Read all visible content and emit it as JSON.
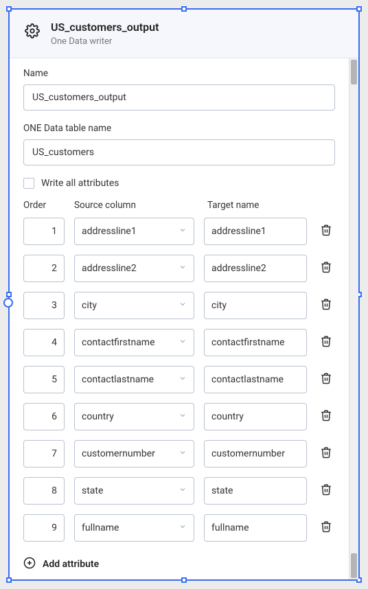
{
  "header": {
    "title": "US_customers_output",
    "subtitle": "One Data writer"
  },
  "fields": {
    "name_label": "Name",
    "name_value": "US_customers_output",
    "table_label": "ONE Data table name",
    "table_value": "US_customers",
    "write_all_label": "Write all attributes"
  },
  "grid_headers": {
    "order": "Order",
    "source": "Source column",
    "target": "Target name"
  },
  "rows": [
    {
      "order": "1",
      "source": "addressline1",
      "target": "addressline1"
    },
    {
      "order": "2",
      "source": "addressline2",
      "target": "addressline2"
    },
    {
      "order": "3",
      "source": "city",
      "target": "city"
    },
    {
      "order": "4",
      "source": "contactfirstname",
      "target": "contactfirstname"
    },
    {
      "order": "5",
      "source": "contactlastname",
      "target": "contactlastname"
    },
    {
      "order": "6",
      "source": "country",
      "target": "country"
    },
    {
      "order": "7",
      "source": "customernumber",
      "target": "customernumber"
    },
    {
      "order": "8",
      "source": "state",
      "target": "state"
    },
    {
      "order": "9",
      "source": "fullname",
      "target": "fullname"
    }
  ],
  "add_label": "Add attribute"
}
